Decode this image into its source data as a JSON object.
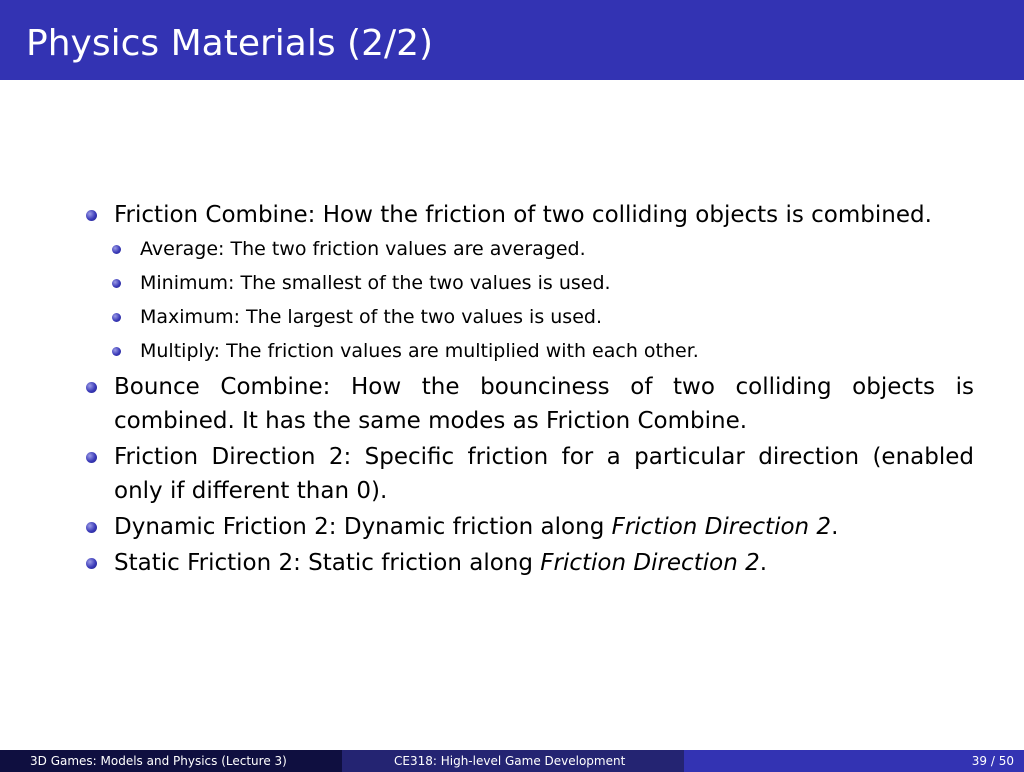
{
  "slide": {
    "title": "Physics Materials (2/2)"
  },
  "bullets": {
    "friction_combine": {
      "text": "Friction Combine: How the friction of two colliding objects is combined.",
      "modes": [
        "Average: The two friction values are averaged.",
        "Minimum: The smallest of the two values is used.",
        "Maximum: The largest of the two values is used.",
        "Multiply: The friction values are multiplied with each other."
      ]
    },
    "bounce_combine": "Bounce Combine: How the bounciness of two colliding objects is combined. It has the same modes as Friction Combine.",
    "friction_direction": "Friction Direction 2: Specific friction for a particular direction (enabled only if different than 0).",
    "dynamic_friction": {
      "text": "Dynamic Friction 2: Dynamic friction along ",
      "emphasis": "Friction Direction 2",
      "end": "."
    },
    "static_friction": {
      "text": "Static Friction 2: Static friction along ",
      "emphasis": "Friction Direction 2",
      "end": "."
    }
  },
  "footer": {
    "left": "3D Games: Models and Physics  (Lecture 3)",
    "center": "CE318: High-level Game Development",
    "right": "39 / 50"
  },
  "colors": {
    "header": "#3333b3",
    "footer_dark": "#0f0f40",
    "footer_mid": "#242472",
    "footer_light": "#3333b3",
    "bullet": "#3a3ab8"
  }
}
